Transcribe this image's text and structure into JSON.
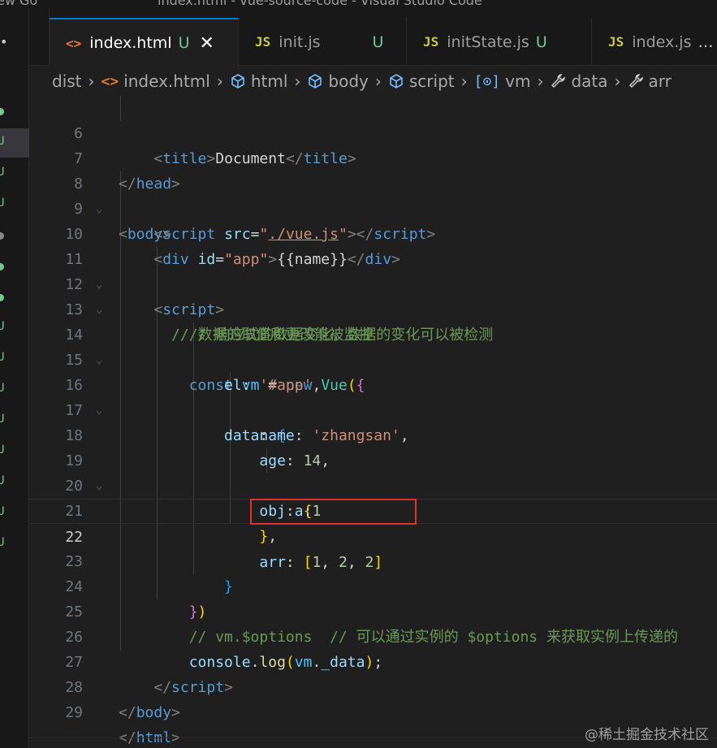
{
  "titlebar": {
    "left_fragment": "ew  Go",
    "center_fragment": "index.html - vue-source-code - Visual Studio Code"
  },
  "tabs": [
    {
      "icon": "<>",
      "label": "index.html",
      "badge": "U",
      "close": "✕",
      "active": true
    },
    {
      "icon": "JS",
      "label": "init.js",
      "badge": "U",
      "active": false
    },
    {
      "icon": "JS",
      "label": "initState.js",
      "badge": "U",
      "active": false
    },
    {
      "icon": "JS",
      "label": "index.js",
      "badge": "",
      "more": "…",
      "active": false
    }
  ],
  "breadcrumb": [
    {
      "icon": "",
      "label": "dist"
    },
    {
      "icon": "<>",
      "label": "index.html"
    },
    {
      "icon": "cube",
      "label": "html"
    },
    {
      "icon": "cube",
      "label": "body"
    },
    {
      "icon": "cube",
      "label": "script"
    },
    {
      "icon": "[⊙]",
      "label": "vm"
    },
    {
      "icon": "wrench",
      "label": "data"
    },
    {
      "icon": "wrench",
      "label": "arr"
    }
  ],
  "editor": {
    "current_line": "22",
    "line_numbers": [
      "6",
      "7",
      "8",
      "9",
      "10",
      "11",
      "12",
      "13",
      "14",
      "15",
      "16",
      "17",
      "18",
      "19",
      "20",
      "21",
      "22",
      "23",
      "24",
      "25",
      "26",
      "27",
      "28",
      "29"
    ],
    "lines": {
      "l6": {
        "indent": "    ",
        "t1": "<",
        "tag": "title",
        "t2": ">",
        "text": "Document",
        "t3": "</",
        "tag2": "title",
        "t4": ">"
      },
      "l7": {
        "t1": "</",
        "tag": "head",
        "t2": ">"
      },
      "l8": {
        "t1": "<",
        "tag": "body",
        "t2": ">"
      },
      "l9": {
        "indent": "    ",
        "t1": "<",
        "tag": "script",
        "attr": "src",
        "eq": "=",
        "q1": "\"",
        "val": "./vue.js",
        "q2": "\"",
        "t2": "></",
        "tag2": "script",
        "t3": ">"
      },
      "l10": {
        "indent": "    ",
        "t1": "<",
        "tag": "div",
        "attr": "id",
        "eq": "=",
        "val": "\"app\"",
        "t2": ">",
        "text": "{{name}}",
        "t3": "</",
        "tag2": "div",
        "t4": ">"
      },
      "l11": {
        "indent": "    ",
        "t1": "<",
        "tag": "script",
        "t2": ">"
      },
      "l12": {
        "indent": "        ",
        "comment": "// 响应式的数据变化，数据的变化可以被检测"
      },
      "l13": {
        "indent": "      ",
        "comment": "// 数据的取值和更改能被监控"
      },
      "l14": {
        "indent": "        ",
        "kw1": "const",
        "var": "vm",
        "eq": "=",
        "kw2": "new",
        "cls": "Vue",
        "p": "(",
        "b": "{"
      },
      "l15": {
        "indent": "            ",
        "prop": "el",
        "colon": ": ",
        "str": "'#app'",
        "comma": ","
      },
      "l16": {
        "indent": "            ",
        "prop": "data",
        "colon": ": ",
        "b": "{"
      },
      "l17": {
        "indent": "                ",
        "prop": "name",
        "colon": ": ",
        "str": "'zhangsan'",
        "comma": ","
      },
      "l18": {
        "indent": "                ",
        "prop": "age",
        "colon": ": ",
        "num": "14",
        "comma": ","
      },
      "l19": {
        "indent": "                ",
        "prop": "obj",
        "colon": ": ",
        "b": "{"
      },
      "l20": {
        "indent": "                    ",
        "prop": "a",
        "colon": ":",
        "num": "1"
      },
      "l21": {
        "indent": "                ",
        "b": "}",
        "comma": ","
      },
      "l22": {
        "indent": "                ",
        "prop": "arr",
        "colon": ": ",
        "b1": "[",
        "n1": "1",
        "c1": ", ",
        "n2": "2",
        "c2": ", ",
        "n3": "2",
        "b2": "]"
      },
      "l23": {
        "indent": "            ",
        "b": "}"
      },
      "l24": {
        "indent": "        ",
        "b": "}",
        "p": ")"
      },
      "l25": {
        "indent": "        ",
        "comment": "// vm.$options  // 可以通过实例的 $options 来获取实例上传递的"
      },
      "l26": {
        "indent": "        ",
        "obj": "console",
        "dot": ".",
        "fn": "log",
        "p1": "(",
        "var": "vm",
        "dot2": ".",
        "prop": "_data",
        "p2": ")",
        "semi": ";"
      },
      "l27": {
        "indent": "    ",
        "t1": "</",
        "tag": "script",
        "t2": ">"
      },
      "l28": {
        "t1": "</",
        "tag": "body",
        "t2": ">"
      },
      "l29": {
        "t1": "</",
        "tag": "html",
        "t2": ">"
      }
    }
  },
  "leftstrip": {
    "menu_glyph": "•",
    "marks": [
      "U",
      "U",
      "U",
      "U",
      "U",
      "U",
      "U",
      "U",
      "U",
      "U",
      "U",
      "U",
      "U",
      "U"
    ]
  },
  "watermark": "@稀土掘金技术社区",
  "colors": {
    "background": "#1f1f1f",
    "tab_active_border": "#0078d4",
    "highlight_box": "#e0312e",
    "untracked_badge": "#73c991"
  }
}
